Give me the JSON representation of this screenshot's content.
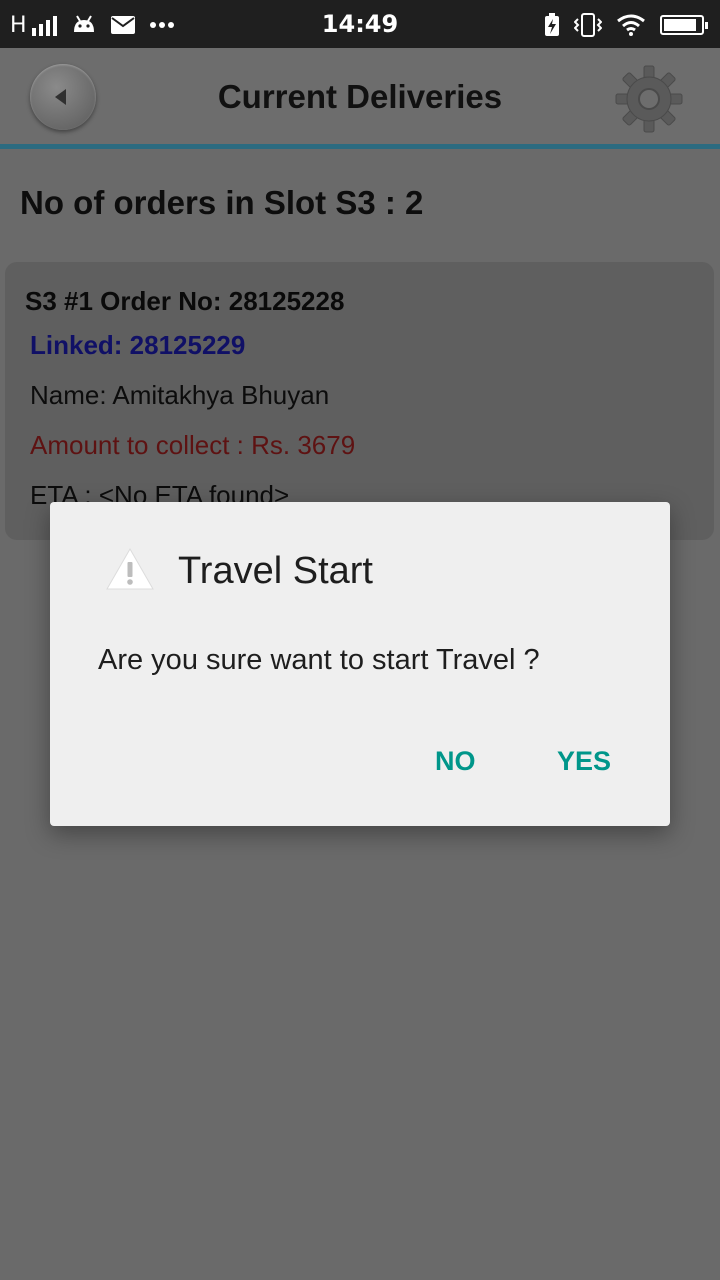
{
  "status_bar": {
    "carrier": "H",
    "time": "14:49",
    "battery_level": 0.9
  },
  "toolbar": {
    "title": "Current Deliveries"
  },
  "slot": {
    "heading": "No of orders in Slot S3 : 2"
  },
  "order_card": {
    "order_line": "S3 #1 Order No: 28125228",
    "linked": "Linked: 28125229",
    "name": "Name: Amitakhya Bhuyan",
    "amount": "Amount to collect : Rs. 3679",
    "eta": "ETA : <No ETA found>"
  },
  "dialog": {
    "title": "Travel Start",
    "message": "Are you sure want to start Travel ?",
    "no_label": "NO",
    "yes_label": "YES"
  },
  "colors": {
    "accent": "#00968a",
    "toolbar_underline": "#2c6b80",
    "linked_text": "#101066",
    "amount_text": "#5e1212"
  }
}
